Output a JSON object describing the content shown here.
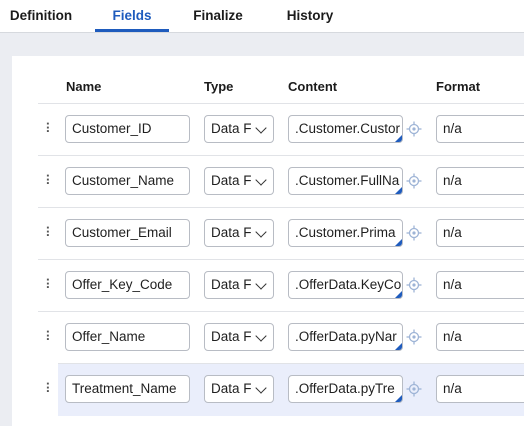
{
  "tabs": [
    {
      "label": "Definition"
    },
    {
      "label": "Fields"
    },
    {
      "label": "Finalize"
    },
    {
      "label": "History"
    }
  ],
  "table": {
    "headers": {
      "name": "Name",
      "type": "Type",
      "content": "Content",
      "format": "Format"
    },
    "rows": [
      {
        "name": "Customer_ID",
        "type": "Data F",
        "content": ".Customer.Custor",
        "format": "n/a"
      },
      {
        "name": "Customer_Name",
        "type": "Data F",
        "content": ".Customer.FullNa",
        "format": "n/a"
      },
      {
        "name": "Customer_Email",
        "type": "Data F",
        "content": ".Customer.Prima",
        "format": "n/a"
      },
      {
        "name": "Offer_Key_Code",
        "type": "Data F",
        "content": ".OfferData.KeyCo",
        "format": "n/a"
      },
      {
        "name": "Offer_Name",
        "type": "Data F",
        "content": ".OfferData.pyNar",
        "format": "n/a"
      },
      {
        "name": "Treatment_Name",
        "type": "Data F",
        "content": ".OfferData.pyTre",
        "format": "n/a"
      }
    ]
  },
  "icons": {
    "drag": "drag-handle-icon",
    "chevron": "chevron-down-icon",
    "target": "crosshair-target-icon"
  },
  "colors": {
    "accent": "#1e5bbd",
    "highlight_row": "#eaeefb",
    "background": "#ebedf2"
  }
}
